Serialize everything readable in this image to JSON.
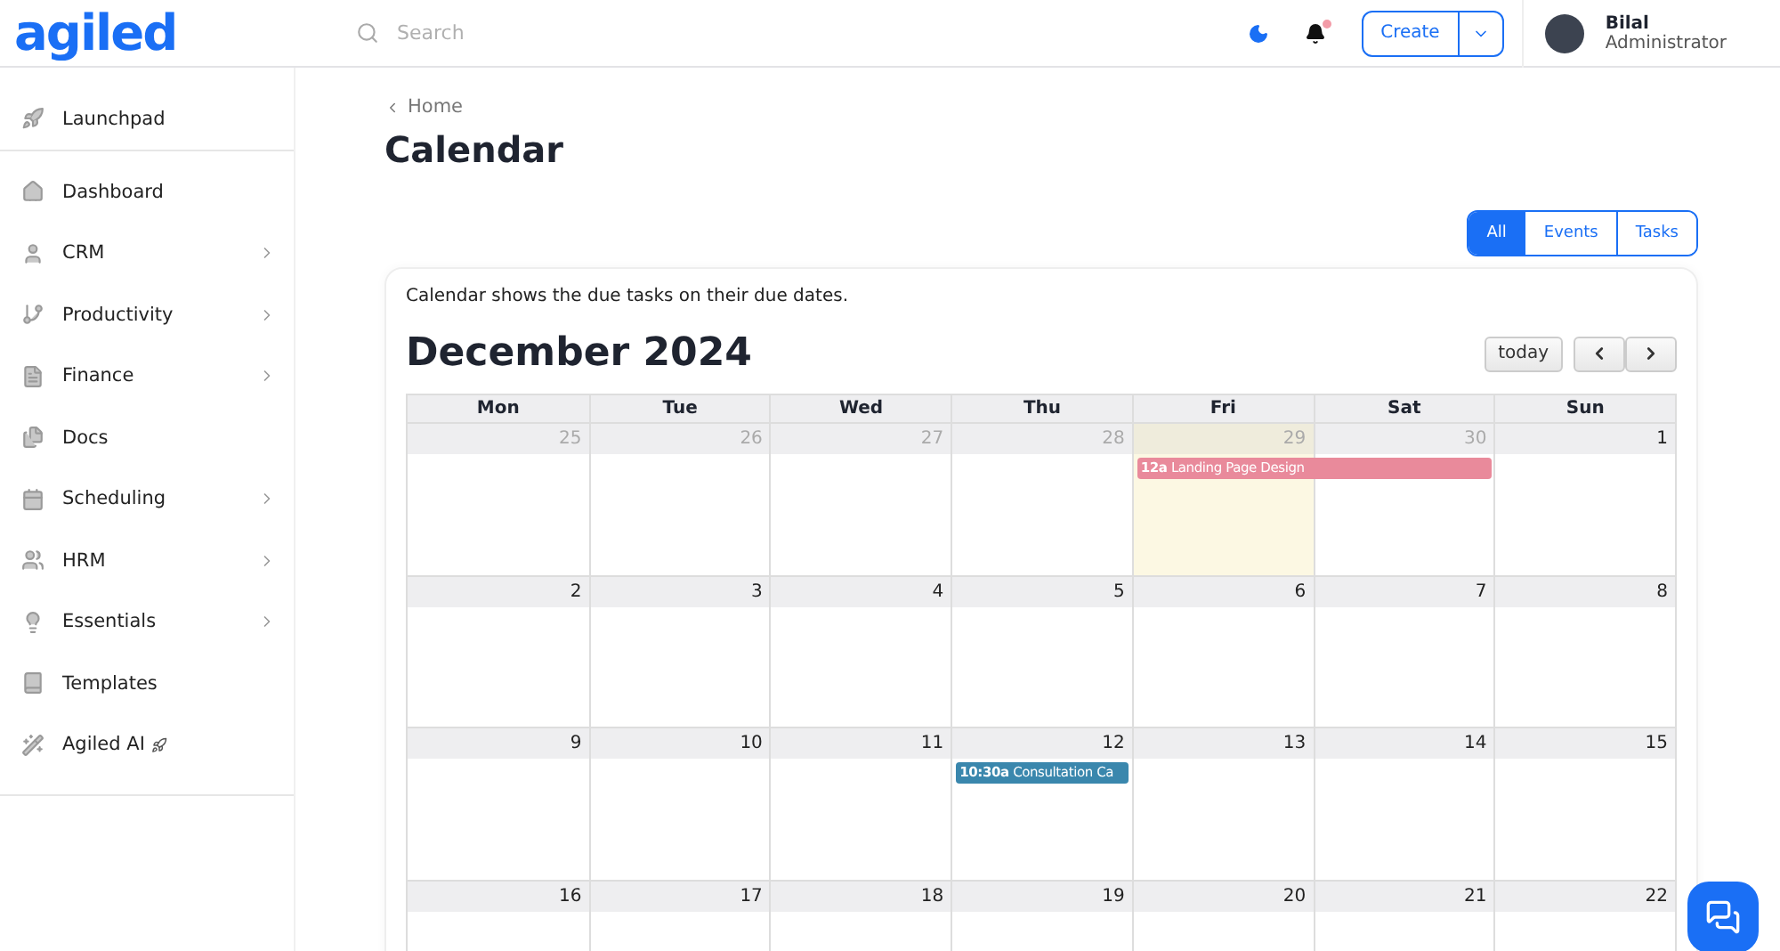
{
  "header": {
    "logo": "agiled",
    "search": {
      "placeholder": "Search"
    },
    "create_button": "Create",
    "user": {
      "name": "Bilal",
      "role": "Administrator"
    },
    "notification_unread": true
  },
  "sidebar": {
    "items": [
      {
        "label": "Launchpad",
        "expandable": false
      },
      {
        "label": "Dashboard",
        "expandable": false
      },
      {
        "label": "CRM",
        "expandable": true
      },
      {
        "label": "Productivity",
        "expandable": true
      },
      {
        "label": "Finance",
        "expandable": true
      },
      {
        "label": "Docs",
        "expandable": false
      },
      {
        "label": "Scheduling",
        "expandable": true
      },
      {
        "label": "HRM",
        "expandable": true
      },
      {
        "label": "Essentials",
        "expandable": true
      },
      {
        "label": "Templates",
        "expandable": false
      },
      {
        "label": "Agiled AI",
        "expandable": false
      }
    ]
  },
  "breadcrumb": "Home",
  "page_title": "Calendar",
  "filter_tabs": [
    {
      "label": "All",
      "selected": true
    },
    {
      "label": "Events",
      "selected": false
    },
    {
      "label": "Tasks",
      "selected": false
    }
  ],
  "calendar": {
    "note": "Calendar shows the due tasks on their due dates.",
    "month_title": "December 2024",
    "today_button": "today",
    "weekdays": [
      "Mon",
      "Tue",
      "Wed",
      "Thu",
      "Fri",
      "Sat",
      "Sun"
    ],
    "weeks": [
      {
        "days": [
          {
            "number": "25",
            "outside": true,
            "today": false
          },
          {
            "number": "26",
            "outside": true,
            "today": false
          },
          {
            "number": "27",
            "outside": true,
            "today": false
          },
          {
            "number": "28",
            "outside": true,
            "today": false
          },
          {
            "number": "29",
            "outside": true,
            "today": true,
            "events": [
              {
                "time": "12a",
                "title": "Landing Page Design",
                "color": "#e98a9b",
                "continues_next_day": true
              }
            ]
          },
          {
            "number": "30",
            "outside": true,
            "today": false
          },
          {
            "number": "1",
            "outside": false,
            "today": false
          }
        ]
      },
      {
        "days": [
          {
            "number": "2",
            "outside": false,
            "today": false
          },
          {
            "number": "3",
            "outside": false,
            "today": false
          },
          {
            "number": "4",
            "outside": false,
            "today": false
          },
          {
            "number": "5",
            "outside": false,
            "today": false
          },
          {
            "number": "6",
            "outside": false,
            "today": false
          },
          {
            "number": "7",
            "outside": false,
            "today": false
          },
          {
            "number": "8",
            "outside": false,
            "today": false
          }
        ]
      },
      {
        "days": [
          {
            "number": "9",
            "outside": false,
            "today": false
          },
          {
            "number": "10",
            "outside": false,
            "today": false
          },
          {
            "number": "11",
            "outside": false,
            "today": false
          },
          {
            "number": "12",
            "outside": false,
            "today": false,
            "events": [
              {
                "time": "10:30a",
                "title": "Consultation Ca",
                "color": "#3a87ad",
                "continues_next_day": false
              }
            ]
          },
          {
            "number": "13",
            "outside": false,
            "today": false
          },
          {
            "number": "14",
            "outside": false,
            "today": false
          },
          {
            "number": "15",
            "outside": false,
            "today": false
          }
        ]
      },
      {
        "days": [
          {
            "number": "16",
            "outside": false,
            "today": false
          },
          {
            "number": "17",
            "outside": false,
            "today": false
          },
          {
            "number": "18",
            "outside": false,
            "today": false
          },
          {
            "number": "19",
            "outside": false,
            "today": false
          },
          {
            "number": "20",
            "outside": false,
            "today": false
          },
          {
            "number": "21",
            "outside": false,
            "today": false
          },
          {
            "number": "22",
            "outside": false,
            "today": false
          }
        ]
      }
    ]
  }
}
